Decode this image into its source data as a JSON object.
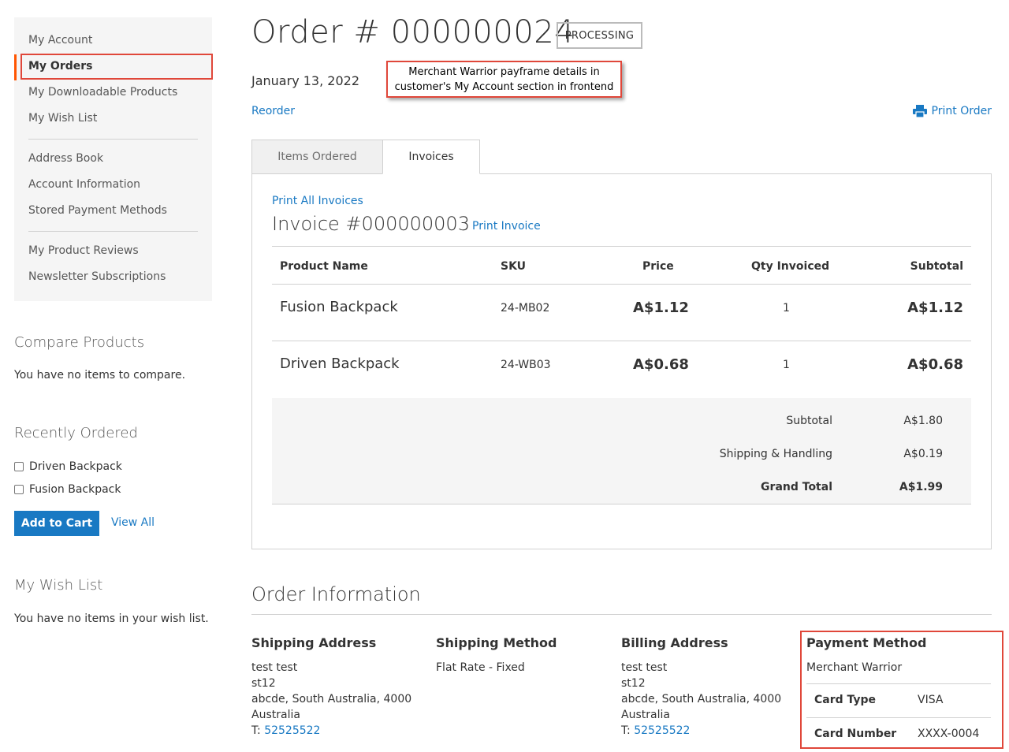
{
  "sidebar": {
    "nav_group1": [
      "My Account",
      "My Orders",
      "My Downloadable Products",
      "My Wish List"
    ],
    "nav_group2": [
      "Address Book",
      "Account Information",
      "Stored Payment Methods"
    ],
    "nav_group3": [
      "My Product Reviews",
      "Newsletter Subscriptions"
    ],
    "compare": {
      "title": "Compare Products",
      "empty_text": "You have no items to compare."
    },
    "recent": {
      "title": "Recently Ordered",
      "items": [
        "Driven Backpack",
        "Fusion Backpack"
      ],
      "add_to_cart": "Add to Cart",
      "view_all": "View All"
    },
    "wishlist": {
      "title": "My Wish List",
      "empty_text": "You have no items in your wish list."
    }
  },
  "order": {
    "title": "Order # 000000024",
    "status": "PROCESSING",
    "date": "January 13, 2022",
    "reorder": "Reorder",
    "print_order": "Print Order"
  },
  "callout": {
    "line1": "Merchant Warrior payframe details in",
    "line2": "customer's My Account section in frontend"
  },
  "tabs": [
    "Items Ordered",
    "Invoices"
  ],
  "invoice": {
    "print_all": "Print All Invoices",
    "title": "Invoice #000000003",
    "print_invoice": "Print Invoice",
    "columns": [
      "Product Name",
      "SKU",
      "Price",
      "Qty Invoiced",
      "Subtotal"
    ],
    "rows": [
      {
        "name": "Fusion Backpack",
        "sku": "24-MB02",
        "price": "A$1.12",
        "qty": "1",
        "subtotal": "A$1.12"
      },
      {
        "name": "Driven Backpack",
        "sku": "24-WB03",
        "price": "A$0.68",
        "qty": "1",
        "subtotal": "A$0.68"
      }
    ],
    "totals": [
      {
        "label": "Subtotal",
        "value": "A$1.80"
      },
      {
        "label": "Shipping & Handling",
        "value": "A$0.19"
      },
      {
        "label": "Grand Total",
        "value": "A$1.99"
      }
    ]
  },
  "order_info": {
    "title": "Order Information",
    "shipping_address": {
      "title": "Shipping Address",
      "lines": [
        "test test",
        "st12",
        "abcde, South Australia, 4000",
        "Australia"
      ],
      "phone_prefix": "T: ",
      "phone": "52525522"
    },
    "shipping_method": {
      "title": "Shipping Method",
      "value": "Flat Rate - Fixed"
    },
    "billing_address": {
      "title": "Billing Address",
      "lines": [
        "test test",
        "st12",
        "abcde, South Australia, 4000",
        "Australia"
      ],
      "phone_prefix": "T: ",
      "phone": "52525522"
    },
    "payment_method": {
      "title": "Payment Method",
      "name": "Merchant Warrior",
      "card_type_label": "Card Type",
      "card_type": "VISA",
      "card_number_label": "Card Number",
      "card_number": "XXXX-0004"
    }
  },
  "colors": {
    "link": "#1979c3",
    "highlight": "#e0473a",
    "current_nav": "#ff5501"
  }
}
